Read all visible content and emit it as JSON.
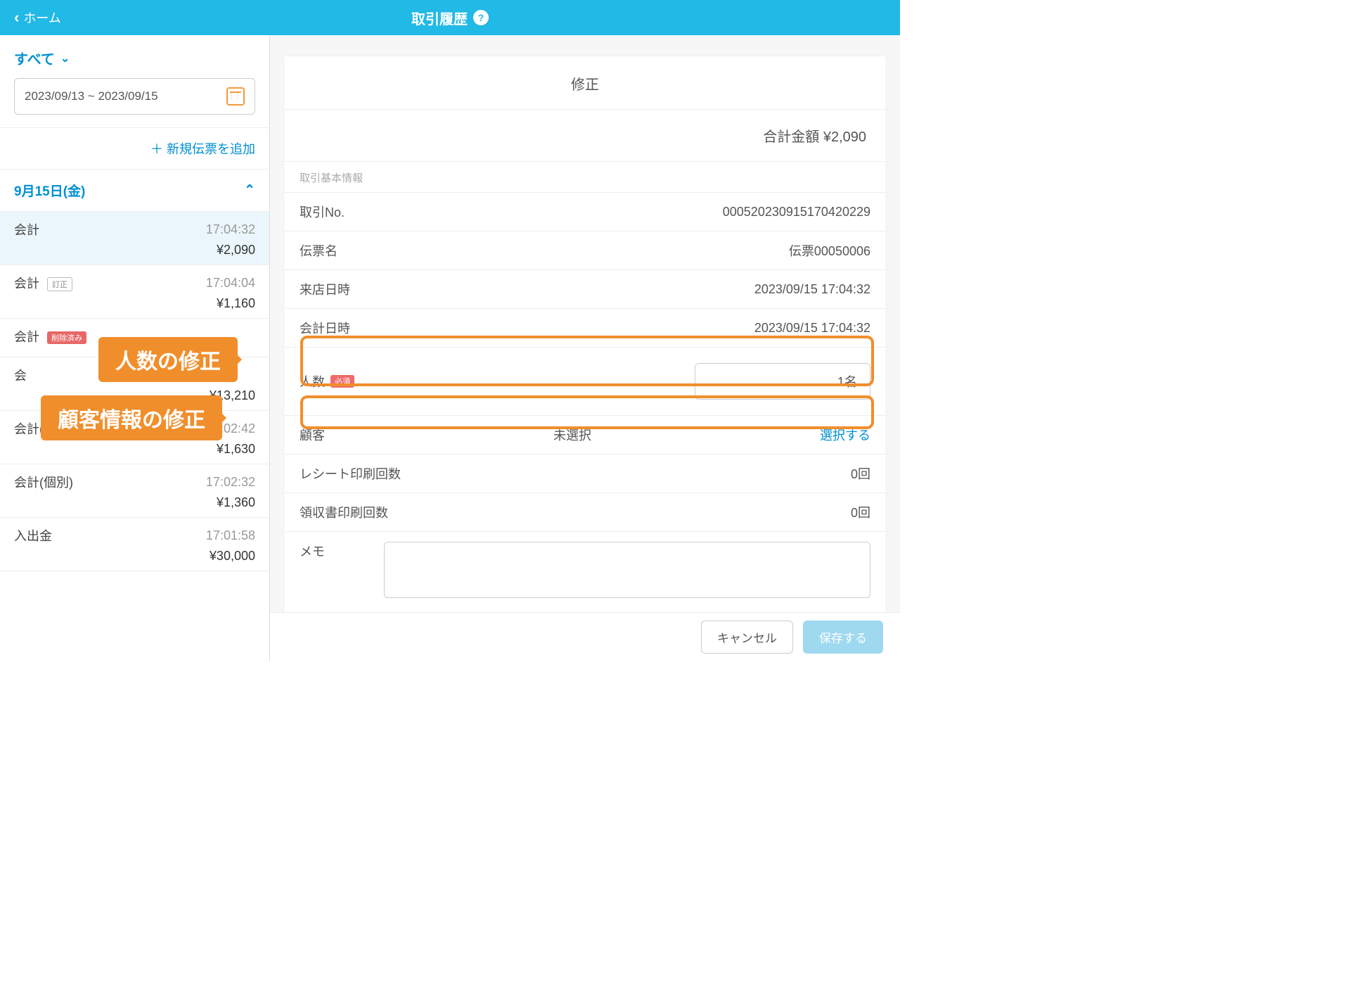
{
  "header": {
    "back_label": "ホーム",
    "title": "取引履歴"
  },
  "sidebar": {
    "filter_label": "すべて",
    "date_range": "2023/09/13 ~ 2023/09/15",
    "add_slip_label": "＋ 新規伝票を追加",
    "date_header": "9月15日(金)",
    "items": [
      {
        "type": "会計",
        "tag": "",
        "time": "17:04:32",
        "amount": "¥2,090",
        "selected": true
      },
      {
        "type": "会計",
        "tag": "訂正",
        "time": "17:04:04",
        "amount": "¥1,160",
        "selected": false
      },
      {
        "type": "会計",
        "tag": "削除済み",
        "time": "",
        "amount": "",
        "selected": false
      },
      {
        "type": "会",
        "tag": "",
        "time": "",
        "amount": "¥13,210",
        "selected": false
      },
      {
        "type": "会計(個別)",
        "tag": "",
        "time": "17:02:42",
        "amount": "¥1,630",
        "selected": false
      },
      {
        "type": "会計(個別)",
        "tag": "",
        "time": "17:02:32",
        "amount": "¥1,360",
        "selected": false
      },
      {
        "type": "入出金",
        "tag": "",
        "time": "17:01:58",
        "amount": "¥30,000",
        "selected": false
      }
    ]
  },
  "detail": {
    "panel_title": "修正",
    "total_label": "合計金額",
    "total_value": "¥2,090",
    "section_label": "取引基本情報",
    "rows": {
      "txn_no_label": "取引No.",
      "txn_no_value": "000520230915170420229",
      "slip_label": "伝票名",
      "slip_value": "伝票00050006",
      "visit_label": "来店日時",
      "visit_value": "2023/09/15 17:04:32",
      "account_label": "会計日時",
      "account_value": "2023/09/15 17:04:32",
      "people_label": "人数",
      "required_badge": "必須",
      "people_value": "1名",
      "cust_label": "顧客",
      "cust_value": "未選択",
      "cust_select": "選択する",
      "receipt_count_label": "レシート印刷回数",
      "receipt_count_value": "0回",
      "invoice_count_label": "領収書印刷回数",
      "invoice_count_value": "0回",
      "memo_label": "メモ"
    }
  },
  "footer": {
    "cancel": "キャンセル",
    "save": "保存する"
  },
  "callouts": {
    "people": "人数の修正",
    "customer": "顧客情報の修正"
  }
}
